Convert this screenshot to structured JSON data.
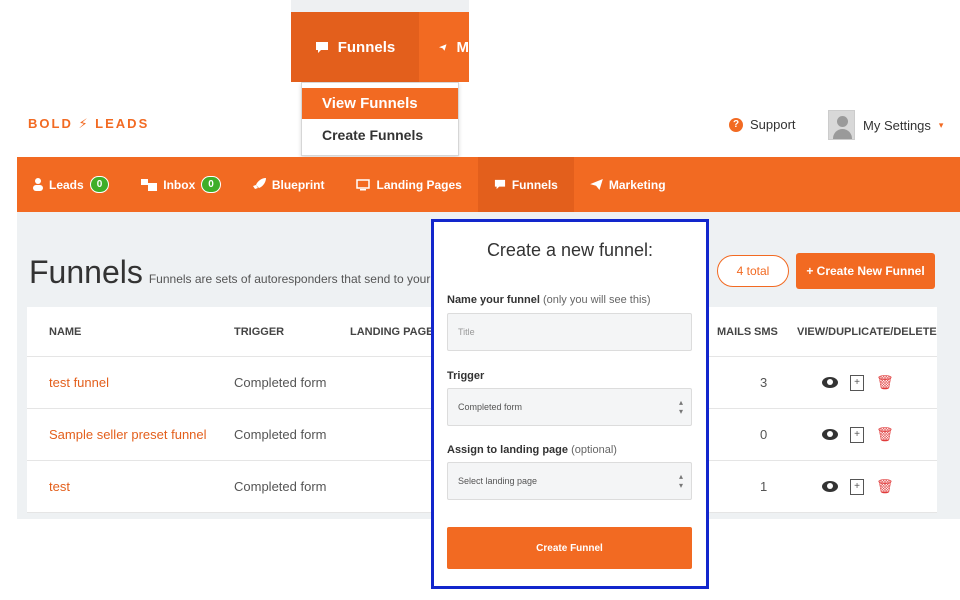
{
  "top_menu": {
    "active_label": "Funnels",
    "next_label": "M",
    "dropdown": [
      "View Funnels",
      "Create Funnels"
    ]
  },
  "header": {
    "logo": "BOLD ⚡ LEADS",
    "support": "Support",
    "settings": "My Settings",
    "settings_caret": "▾"
  },
  "nav": {
    "items": [
      {
        "label": "Leads",
        "badge": "0",
        "icon": "person-icon"
      },
      {
        "label": "Inbox",
        "badge": "0",
        "icon": "inbox-icon"
      },
      {
        "label": "Blueprint",
        "icon": "rocket-icon"
      },
      {
        "label": "Landing Pages",
        "icon": "monitor-icon"
      },
      {
        "label": "Funnels",
        "icon": "speech-bubble-icon"
      },
      {
        "label": "Marketing",
        "icon": "paper-plane-icon"
      }
    ]
  },
  "page": {
    "title": "Funnels",
    "subtitle": "Funnels are sets of autoresponders that send to your lead",
    "total": "4 total",
    "create_button": "+ Create New Funnel"
  },
  "table": {
    "headers": {
      "name": "NAME",
      "trigger": "TRIGGER",
      "landing": "LANDING PAGE",
      "emails": "MAILS",
      "sms": "SMS",
      "actions": "VIEW/DUPLICATE/DELETE"
    },
    "rows": [
      {
        "name": "test funnel",
        "trigger": "Completed form",
        "sms": "3"
      },
      {
        "name": "Sample seller preset funnel",
        "trigger": "Completed form",
        "sms": "0"
      },
      {
        "name": "test",
        "trigger": "Completed form",
        "sms": "1"
      }
    ]
  },
  "modal": {
    "title": "Create a new funnel:",
    "name_label": "Name your funnel",
    "name_hint": "(only you will see this)",
    "name_placeholder": "Title",
    "trigger_label": "Trigger",
    "trigger_value": "Completed form",
    "landing_label": "Assign to landing page",
    "landing_hint": "(optional)",
    "landing_value": "Select landing page",
    "submit": "Create Funnel"
  },
  "colors": {
    "accent": "#f26a22",
    "accent_dark": "#e35f1c",
    "badge": "#3fae29",
    "highlight_border": "#1226cc"
  }
}
